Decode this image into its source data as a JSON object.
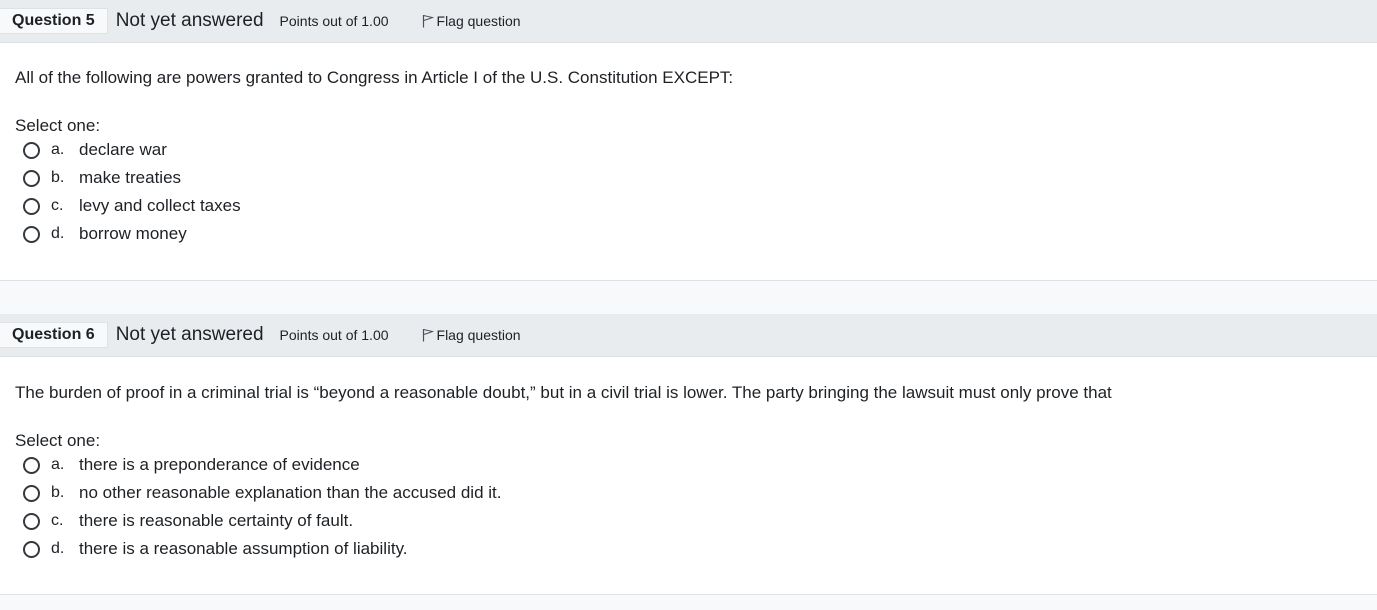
{
  "questions": [
    {
      "number_label": "Question 5",
      "state": "Not yet answered",
      "grade": "Points out of 1.00",
      "flag_label": "Flag question",
      "text": "All of the following are powers granted to Congress in Article I of the U.S. Constitution EXCEPT:",
      "prompt": "Select one:",
      "answers": [
        {
          "letter": "a.",
          "text": "declare war"
        },
        {
          "letter": "b.",
          "text": "make treaties"
        },
        {
          "letter": "c.",
          "text": "levy and collect taxes"
        },
        {
          "letter": "d.",
          "text": "borrow money"
        }
      ]
    },
    {
      "number_label": "Question 6",
      "state": "Not yet answered",
      "grade": "Points out of 1.00",
      "flag_label": "Flag question",
      "text": "The burden of proof in a criminal trial is “beyond a reasonable doubt,” but in a civil trial is lower. The party bringing the lawsuit must only prove that",
      "prompt": "Select one:",
      "answers": [
        {
          "letter": "a.",
          "text": "there is a preponderance of evidence"
        },
        {
          "letter": "b.",
          "text": "no other reasonable explanation than the accused did it."
        },
        {
          "letter": "c.",
          "text": "there is reasonable certainty of fault."
        },
        {
          "letter": "d.",
          "text": "there is a reasonable assumption of liability."
        }
      ]
    }
  ]
}
